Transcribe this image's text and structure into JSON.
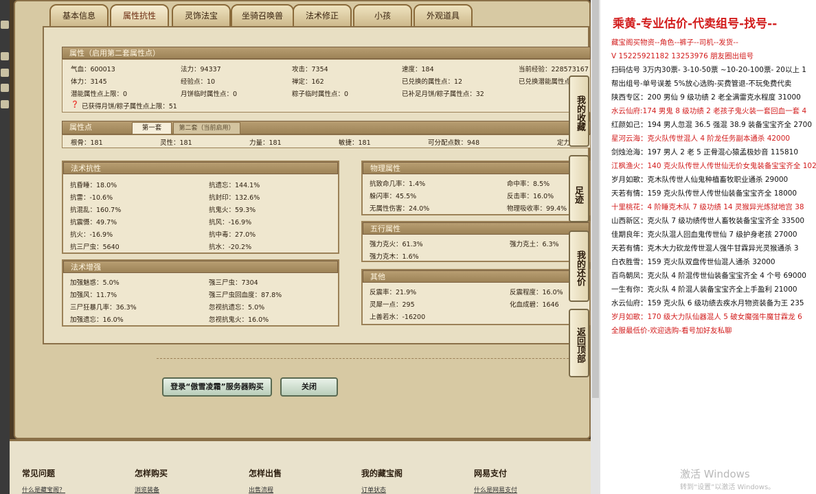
{
  "tabs": [
    "基本信息",
    "属性抗性",
    "灵饰法宝",
    "坐骑召唤兽",
    "法术修正",
    "小孩",
    "外观道具"
  ],
  "attr_header": "属性（启用第二套属性点）",
  "attr_rows": [
    [
      "气血：600013",
      "法力：94337",
      "攻击：7354",
      "速度：184",
      "当前经验：228573167"
    ],
    [
      "体力：3145",
      "经验点：10",
      "禅定：162",
      "已兑换的属性点：12",
      "已兑换潜能属性点"
    ],
    [
      "潜能属性点上限：0",
      "月饼临时属性点：0",
      "粽子临时属性点：0",
      "已补足月饼/粽子属性点：32",
      ""
    ]
  ],
  "attr_note": "已获得月饼/粽子属性点上限：51",
  "points_header": "属性点",
  "points_tab1": "第一套",
  "points_tab2": "第二套（当前启用）",
  "points_row": [
    "根骨：181",
    "灵性：181",
    "力量：181",
    "敏捷：181",
    "可分配点数：948",
    "定力"
  ],
  "spell_res_header": "法术抗性",
  "spell_res": [
    [
      "抗昏睡：18.0%",
      "抗遗忘：144.1%"
    ],
    [
      "抗雷：-10.6%",
      "抗封印：132.6%"
    ],
    [
      "抗混乱：160.7%",
      "抗鬼火：59.3%"
    ],
    [
      "抗震慑：49.7%",
      "抗风：-16.9%"
    ],
    [
      "抗火：-16.9%",
      "抗中毒：27.0%"
    ],
    [
      "抗三尸虫：5640",
      "抗水：-20.2%"
    ]
  ],
  "phys_header": "物理属性",
  "phys": [
    [
      "抗致命几率：1.4%",
      "命中率：8.5%"
    ],
    [
      "躲闪率：45.5%",
      "反击率：16.0%"
    ],
    [
      "无属性伤害：24.0%",
      "物理吸收率：99.4%"
    ]
  ],
  "elem_header": "五行属性",
  "elem": [
    [
      "强力克火：61.3%",
      "强力克土：6.3%"
    ],
    [
      "强力克木：1.6%",
      ""
    ]
  ],
  "spell_boost_header": "法术增强",
  "spell_boost": [
    [
      "加强魅惑：5.0%",
      "强三尸虫：7304"
    ],
    [
      "加强风：11.7%",
      "强三尸虫回血度：87.8%"
    ],
    [
      "三尸狂暴几率：36.3%",
      "忽视抗遗忘：5.0%"
    ],
    [
      "加强遗忘：16.0%",
      "忽视抗鬼火：16.0%"
    ]
  ],
  "other_header": "其他",
  "other": [
    [
      "反震率：21.9%",
      "反震程度：16.0%"
    ],
    [
      "灵犀一点：295",
      "化血成碧：1646"
    ],
    [
      "上善若水：-16200",
      ""
    ]
  ],
  "buttons": {
    "login": "登录“傲雪凌霜”服务器购买",
    "close": "关闭"
  },
  "side": [
    "我的收藏",
    "足迹",
    "我的还价",
    "返回顶部"
  ],
  "footer": [
    {
      "title": "常见问题",
      "link": "什么是藏宝阁？"
    },
    {
      "title": "怎样购买",
      "link": "浏览装备"
    },
    {
      "title": "怎样出售",
      "link": "出售流程"
    },
    {
      "title": "我的藏宝阁",
      "link": "订单状态"
    },
    {
      "title": "网易支付",
      "link": "什么是网易支付"
    }
  ],
  "right": {
    "title": "乘黄-专业估价-代卖组号-找号--",
    "lines": [
      {
        "t": "藏宝阁买物资--角色--裤子--司机--发货--",
        "red": true
      },
      {
        "t": "V 15225921182  13253976 朋友圈出组号",
        "red": true
      },
      {
        "t": "扫码估号 3万内30票- 3-10-50票  ~10-20-100票- 20以上 1",
        "red": false
      },
      {
        "t": "帮出组号-单号误差 5%放心选购-买费管退-不玩免费代卖",
        "red": false
      },
      {
        "t": "陕西专区：200 男仙 9 级功绩 2 老全满雷克水程度 31000",
        "red": false
      },
      {
        "t": "水云仙府:174 男鬼 8 级功绩 2 老孩子鬼火装一套回血一套 4",
        "red": true
      },
      {
        "t": "红颜如己：194 男人忽混 36.5 强混 38.9 装备宝宝齐全 2700",
        "red": false
      },
      {
        "t": "星河云海：克火队传世混人 4 阶龙任务副本通杀 42000",
        "red": true
      },
      {
        "t": "剑烛沧海：197 男人 2 老 5 正骨混心猿孟极妙音 115810",
        "red": false
      },
      {
        "t": "江枫渔火：140 克火队传世人传世仙无价女鬼装备宝宝齐全 102",
        "red": true
      },
      {
        "t": "岁月如歌：克木队传世人仙鬼种植畜牧职业通杀 29000",
        "red": false
      },
      {
        "t": "天若有情：159 克火队传世人传世仙装备宝宝齐全 18000",
        "red": false
      },
      {
        "t": "十里桃花：4 阶睡克木队 7 级功绩 14 灵猴异光炼狱地宫 38",
        "red": true
      },
      {
        "t": "山西新区：克火队 7 级功绩传世人畜牧装备宝宝齐全 33500",
        "red": false
      },
      {
        "t": "佳期良年：克火队混人回血鬼传世仙 7 级护身老孩 27000",
        "red": false
      },
      {
        "t": "天若有情：克木大力砍龙传世混人强牛甘霖异光灵猴通杀 3",
        "red": false
      },
      {
        "t": "白衣胜雪：159 克火队双盘传世仙混人通杀 32000",
        "red": false
      },
      {
        "t": "百鸟朝凤：克火队 4 阶混传世仙装备宝宝齐全 4 个号 69000",
        "red": false
      },
      {
        "t": "一生有你：克火队 4 阶混人装备宝宝齐全上手盈利 21000",
        "red": false
      },
      {
        "t": "水云仙府：159 克火队 6 级功绩去疾水月物资装备为王 235",
        "red": false
      },
      {
        "t": "岁月如歌：170 级大力队仙器混人 5 破女魔强牛魔甘霖龙 6",
        "red": true
      },
      {
        "t": "全服最低价-欢迎选购-看号加好友私聊",
        "red": true
      }
    ],
    "watermark": "激活 Windows",
    "watermark_sub": "转到“设置”以激活 Windows。"
  }
}
